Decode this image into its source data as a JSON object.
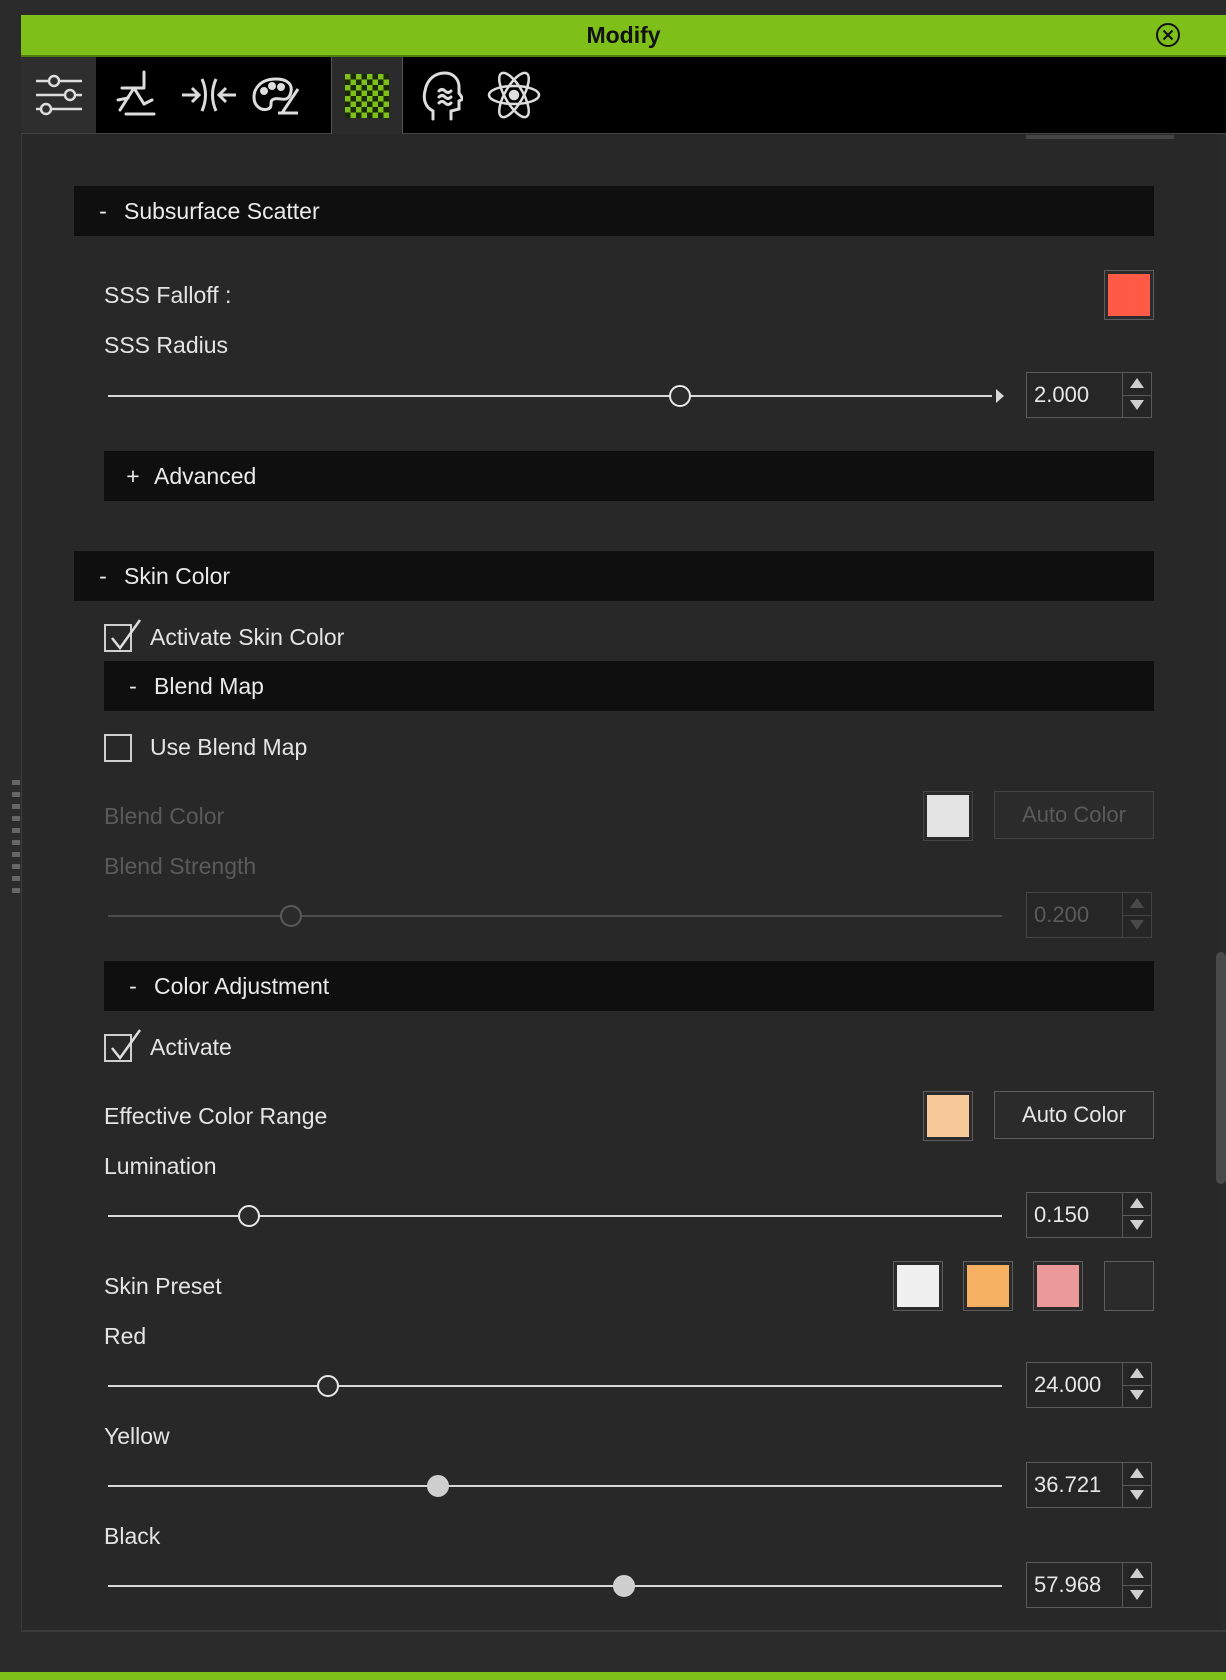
{
  "window": {
    "title": "Modify"
  },
  "tabs": [
    {
      "icon": "sliders-icon"
    },
    {
      "icon": "pose-figure-icon"
    },
    {
      "icon": "morph-arrows-icon"
    },
    {
      "icon": "paint-palette-icon"
    },
    {
      "icon": "checker-material-icon",
      "active": true
    },
    {
      "icon": "head-wave-icon"
    },
    {
      "icon": "atom-physics-icon"
    }
  ],
  "subsurface": {
    "header": "Subsurface Scatter",
    "header_symbol": "-",
    "falloff_label": "SSS Falloff :",
    "falloff_color": "#ff5a45",
    "radius_label": "SSS Radius",
    "radius_value": "2.000",
    "radius_fraction": 0.647,
    "advanced": {
      "symbol": "+",
      "label": "Advanced"
    }
  },
  "skin_color": {
    "header": "Skin Color",
    "header_symbol": "-",
    "activate_label": "Activate Skin Color",
    "activate_checked": true,
    "blend_map": {
      "header": "Blend Map",
      "header_symbol": "-",
      "use_label": "Use Blend Map",
      "use_checked": false,
      "blend_color_label": "Blend Color",
      "blend_color": "#e4e4e4",
      "auto_color_label": "Auto Color",
      "strength_label": "Blend Strength",
      "strength_value": "0.200",
      "strength_fraction": 0.205
    },
    "color_adjustment": {
      "header": "Color Adjustment",
      "header_symbol": "-",
      "activate_label": "Activate",
      "activate_checked": true,
      "range_label": "Effective Color Range",
      "range_color": "#f7c898",
      "auto_color_label": "Auto Color",
      "lumination_label": "Lumination",
      "lumination_value": "0.150",
      "lumination_fraction": 0.158,
      "preset_label": "Skin Preset",
      "presets": [
        "#f0f0f0",
        "#f6b061",
        "#ec9999",
        "#2b2b2b"
      ],
      "red_label": "Red",
      "red_value": "24.000",
      "red_fraction": 0.246,
      "yellow_label": "Yellow",
      "yellow_value": "36.721",
      "yellow_fraction": 0.369,
      "black_label": "Black",
      "black_value": "57.968",
      "black_fraction": 0.577
    }
  }
}
